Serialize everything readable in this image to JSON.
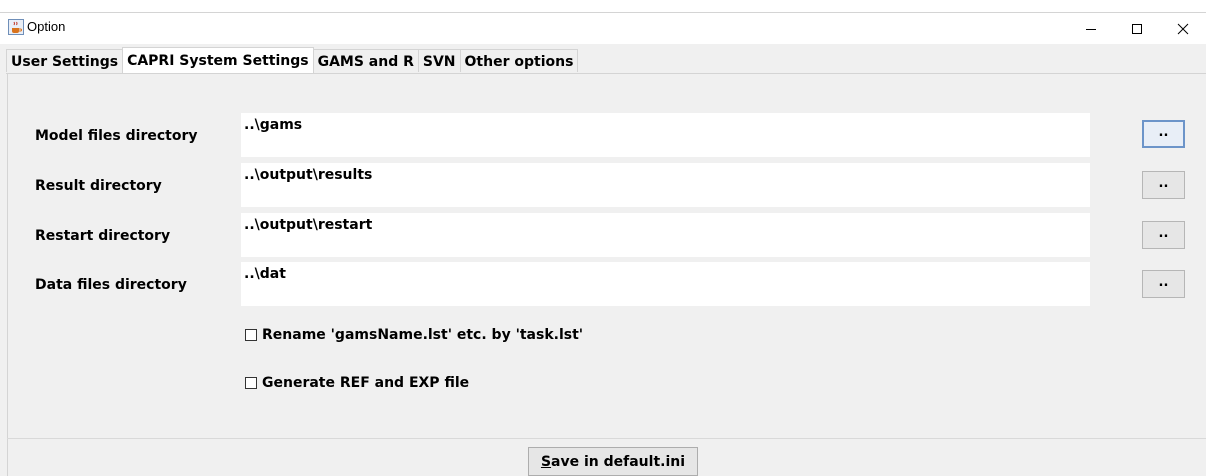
{
  "window": {
    "title": "Option",
    "app_icon": "java-cup-icon",
    "controls": [
      "minimize-icon",
      "maximize-icon",
      "close-icon"
    ]
  },
  "tabs": [
    {
      "label": "User Settings",
      "active": false
    },
    {
      "label": "CAPRI System Settings",
      "active": true
    },
    {
      "label": "GAMS and R",
      "active": false
    },
    {
      "label": "SVN",
      "active": false
    },
    {
      "label": "Other options",
      "active": false
    }
  ],
  "directories": [
    {
      "label": "Model files directory",
      "value": "..\\gams",
      "browse_label": ".."
    },
    {
      "label": "Result directory",
      "value": "..\\output\\results",
      "browse_label": ".."
    },
    {
      "label": "Restart directory",
      "value": "..\\output\\restart",
      "browse_label": ".."
    },
    {
      "label": "Data files directory",
      "value": "..\\dat",
      "browse_label": ".."
    }
  ],
  "options": [
    {
      "label": "Rename 'gamsName.lst' etc. by 'task.lst'",
      "checked": false
    },
    {
      "label": "Generate REF and EXP file",
      "checked": false
    }
  ],
  "footer": {
    "save_mnemonic": "S",
    "save_rest": "ave in default.ini"
  },
  "colors": {
    "panel_bg": "#f0f0f0",
    "field_bg": "#ffffff",
    "focus_border": "#6c94c9"
  }
}
